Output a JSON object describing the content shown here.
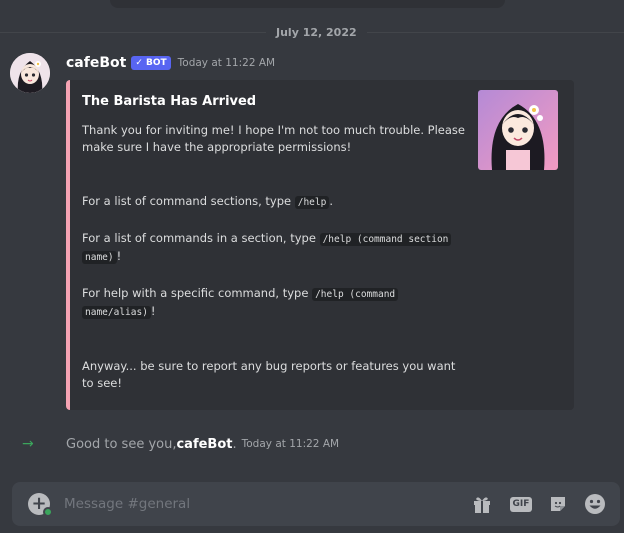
{
  "date_divider": "July 12, 2022",
  "message": {
    "username": "cafeBot",
    "badge": "✓ BOT",
    "timestamp": "Today at 11:22 AM",
    "embed": {
      "accent_color": "#f5a3b3",
      "title": "The Barista Has Arrived",
      "intro": "Thank you for inviting me! I hope I'm not too much trouble. Please make sure I have the appropriate permissions!",
      "line1_prefix": "For a list of command sections, type ",
      "line1_code": "/help",
      "line1_suffix": ".",
      "line2_prefix": "For a list of commands in a section, type ",
      "line2_code_a": "/help (command section",
      "line2_code_b": "name)",
      "line2_suffix": "!",
      "line3_prefix": "For help with a specific command, type ",
      "line3_code_a": "/help (command",
      "line3_code_b": "name/alias)",
      "line3_suffix": "!",
      "outro": "Anyway... be sure to report any bug reports or features you want to see!"
    }
  },
  "join": {
    "prefix": "Good to see you, ",
    "name": "cafeBot",
    "suffix": ".",
    "timestamp": "Today at 11:22 AM"
  },
  "composer": {
    "placeholder": "Message #general",
    "gif_label": "GIF"
  },
  "colors": {
    "background": "#36393f",
    "accent": "#5865f2",
    "online": "#3ba55c"
  }
}
